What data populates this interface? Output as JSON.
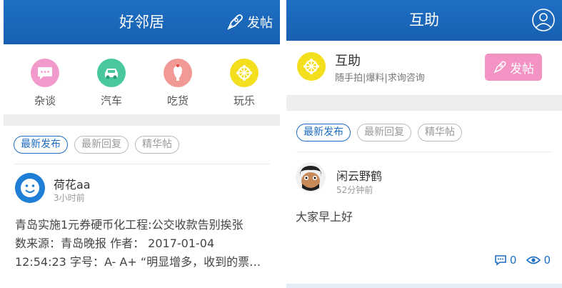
{
  "left": {
    "header": {
      "title": "好邻居",
      "post_label": "发帖"
    },
    "categories": [
      {
        "label": "杂谈",
        "icon": "chat-bubble-icon",
        "color": "#f29acb"
      },
      {
        "label": "汽车",
        "icon": "car-icon",
        "color": "#49c8a0"
      },
      {
        "label": "吃货",
        "icon": "ice-cream-icon",
        "color": "#f19a95"
      },
      {
        "label": "玩乐",
        "icon": "ferris-wheel-icon",
        "color": "#f4df1e"
      }
    ],
    "tabs": [
      "最新发布",
      "最新回复",
      "精华帖"
    ],
    "post": {
      "username": "荷花aa",
      "time": "3小时前",
      "lines": [
        "青岛实施1元券硬币化工程:公交收款告别挨张",
        "数来源：青岛晚报 作者： 2017-01-04",
        "12:54:23 字号：A- A+ “明显增多，收到的票…"
      ]
    }
  },
  "right": {
    "header": {
      "title": "互助"
    },
    "hub": {
      "name": "互助",
      "subtitle": "随手拍|爆料|求询咨询",
      "post_label": "发帖"
    },
    "tabs": [
      "最新发布",
      "最新回复",
      "精华帖"
    ],
    "post": {
      "username": "闲云野鹤",
      "time": "52分钟前",
      "text": "大家早上好",
      "comments": "0",
      "views": "0"
    }
  },
  "colors": {
    "brand_blue": "#1d6dc2",
    "pink_button": "#f293c4"
  }
}
